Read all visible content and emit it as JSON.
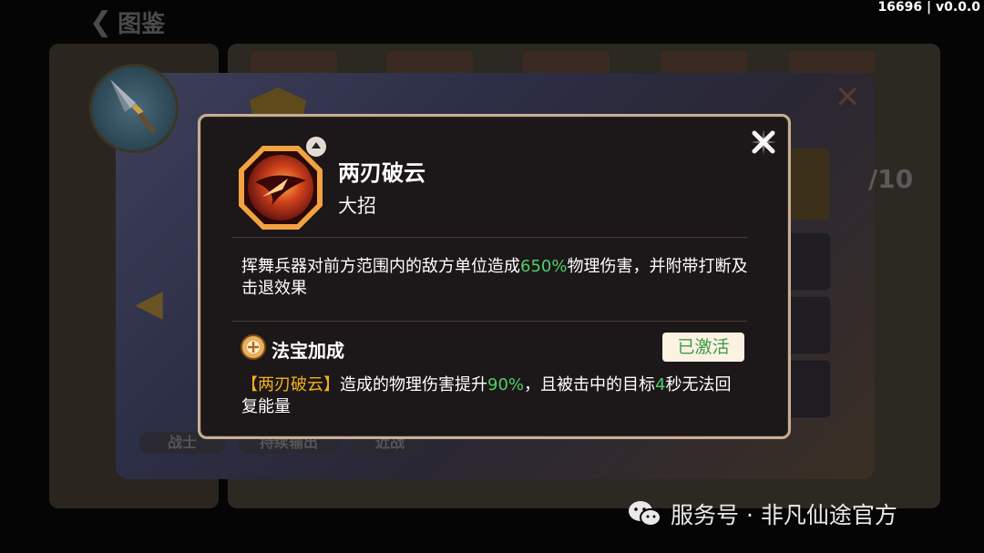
{
  "version": "16696 | v0.0.0",
  "background": {
    "title": "图鉴",
    "tags": [
      "战士",
      "持续输出",
      "近战"
    ],
    "count": "/10"
  },
  "popup": {
    "skill_name": "两刃破云",
    "skill_type": "大招",
    "description": {
      "before": "挥舞兵器对前方范围内的敌方单位造成",
      "value": "650%",
      "after": "物理伤害，并附带打断及击退效果"
    },
    "bonus": {
      "title": "法宝加成",
      "status": "已激活",
      "skill_ref": "【两刃破云】",
      "text1": "造成的物理伤害提升",
      "value1": "90%",
      "text2": "，且被击中的目标",
      "value2": "4",
      "text3": "秒无法回复能量"
    }
  },
  "watermark": {
    "text": "服务号 · 非凡仙途官方"
  },
  "colors": {
    "highlight_green": "#4fcf6a",
    "highlight_orange": "#f2b21e",
    "popup_border": "#c7ae95",
    "popup_bg": "#1c1718"
  },
  "icons": [
    "back-arrow-icon",
    "close-icon",
    "skill-icon",
    "level-up-icon",
    "treasure-icon",
    "wechat-icon"
  ]
}
